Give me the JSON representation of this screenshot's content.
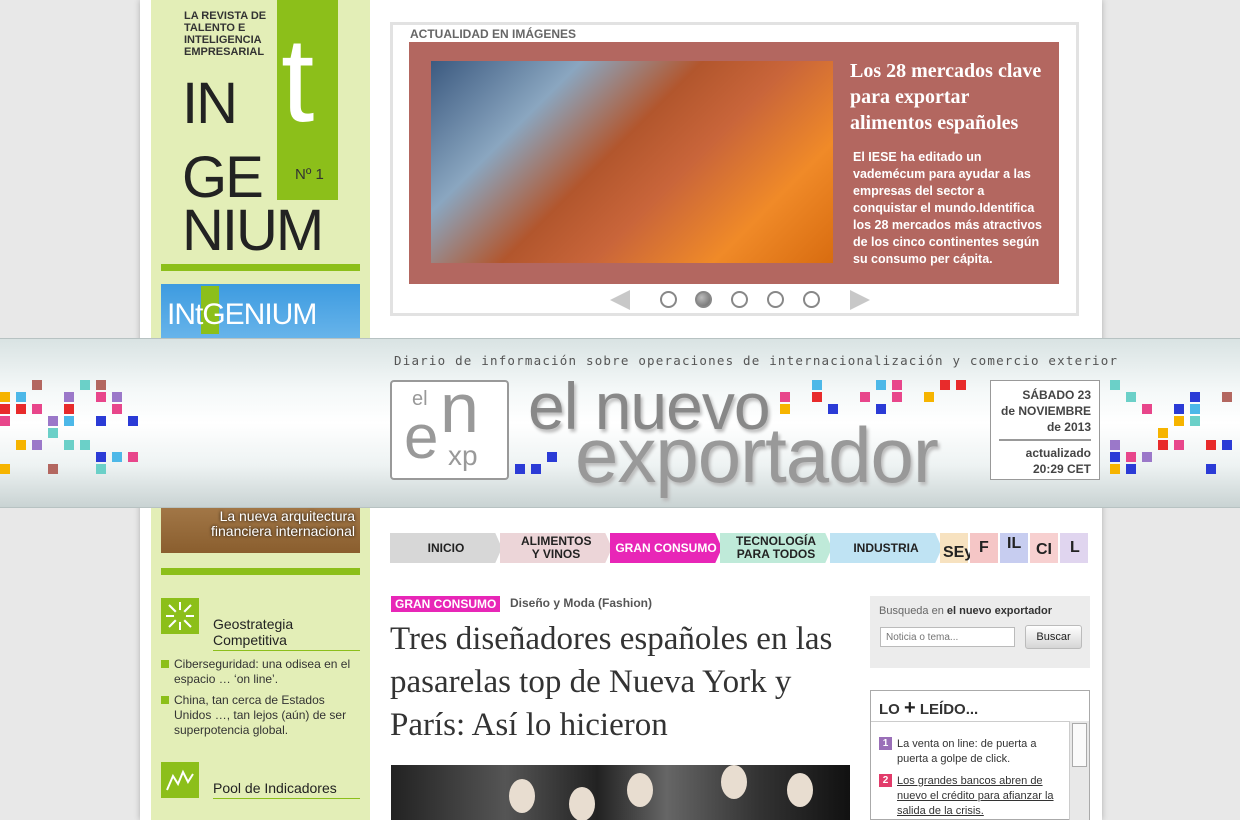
{
  "sidebar": {
    "brand_tagline": "LA REVISTA DE TALENTO E INTELIGENCIA EMPRESARIAL",
    "brand_t": "t",
    "brand_number": "Nº 1",
    "brand_line1": "IN",
    "brand_line2": "GE",
    "brand_line3": "NIUM",
    "cover_title": "INtGENIUM",
    "cover_caption": "La nueva arquitectura financiera internacional",
    "sections": [
      {
        "title": "Geostrategia Competitiva",
        "icon": "starburst-icon"
      },
      {
        "title": "Pool de Indicadores",
        "icon": "line-chart-icon"
      }
    ],
    "links": [
      "Ciberseguridad: una odisea en el espacio … ‘on line’.",
      "China, tan cerca de Estados Unidos …, tan lejos (aún) de ser superpotencia global."
    ]
  },
  "slideshow": {
    "label": "ACTUALIDAD EN IMÁGENES",
    "title": "Los 28 mercados clave para exportar alimentos españoles",
    "text": "El IESE ha editado un vademécum para ayudar a las empresas del sector a conquistar el mundo.Identifica los 28 mercados más atractivos de los cinco continentes según su consumo per cápita.",
    "active_index": 1,
    "dot_count": 5,
    "panel_color": "#b36760"
  },
  "masthead": {
    "tagline": "Diario de información sobre operaciones de internacionalización y comercio exterior",
    "logo_el": "el",
    "logo_n": "n",
    "logo_e": "e",
    "logo_xp": "xp",
    "name_line1": "el nuevo",
    "name_line2": "exportador",
    "date_line1": "SÁBADO 23",
    "date_line2": "de NOVIEMBRE",
    "date_line3": "de 2013",
    "updated_label": "actualizado",
    "updated_time": "20:29  CET"
  },
  "nav": {
    "items": [
      {
        "label": "INICIO",
        "color": "#d7d7d7"
      },
      {
        "label": "ALIMENTOS Y VINOS",
        "color": "#ecd5d8"
      },
      {
        "label": "GRAN CONSUMO",
        "color": "#e826b7"
      },
      {
        "label": "TECNOLOGÍA PARA TODOS",
        "color": "#bfead9"
      },
      {
        "label": "INDUSTRIA",
        "color": "#bfe3f3"
      }
    ],
    "letters": [
      {
        "label": "SEy",
        "color": "#f7e2c0"
      },
      {
        "label": "F",
        "color": "#f5c6c6"
      },
      {
        "label": "IL",
        "color": "#c7cdf0"
      },
      {
        "label": "CI",
        "color": "#f7d0d0"
      },
      {
        "label": "L",
        "color": "#e0d5ef"
      }
    ]
  },
  "article": {
    "category": "GRAN CONSUMO",
    "subcategory": "Diseño y Moda (Fashion)",
    "headline": "Tres diseñadores españoles en las pasarelas top de Nueva York y París: Así lo hicieron"
  },
  "search": {
    "label_prefix": "Busqueda en ",
    "label_brand": "el nuevo exportador",
    "placeholder": "Noticia o tema...",
    "button": "Buscar"
  },
  "most_read": {
    "title_prefix": "LO",
    "title_plus": "+",
    "title_suffix": "LEÍDO...",
    "items": [
      {
        "num": "1",
        "text": "La venta on line: de puerta a puerta a golpe de click.",
        "color": "#9a6fb8"
      },
      {
        "num": "2",
        "text": "Los grandes bancos abren de nuevo el crédito para afianzar la salida de la crisis.",
        "color": "#e23b6a"
      }
    ]
  }
}
